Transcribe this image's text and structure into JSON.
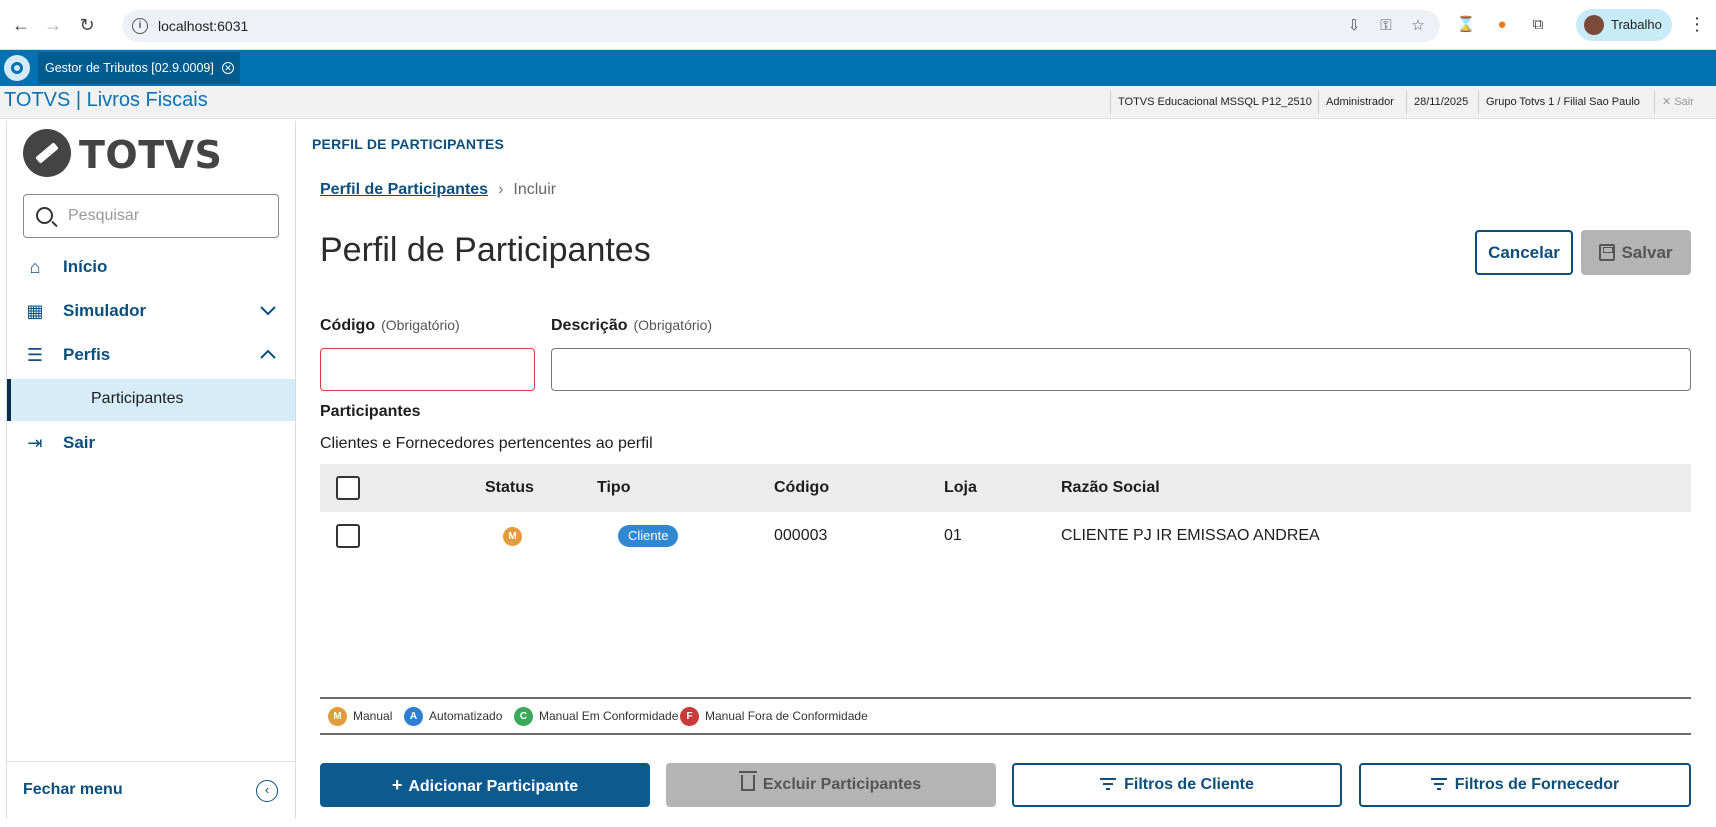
{
  "browser": {
    "url": "localhost:6031",
    "profile_label": "Trabalho"
  },
  "app_tab": {
    "title": "Gestor de Tributos [02.9.0009]"
  },
  "header": {
    "title": "TOTVS | Livros Fiscais",
    "environment": "TOTVS Educacional MSSQL P12_2510",
    "user": "Administrador",
    "date": "28/11/2025",
    "company": "Grupo Totvs 1 / Filial Sao Paulo",
    "exit_label": "Sair"
  },
  "sidebar": {
    "brand": "TOTVS",
    "search_placeholder": "Pesquisar",
    "items": [
      {
        "label": "Início",
        "icon": "home-icon"
      },
      {
        "label": "Simulador",
        "icon": "calculator-icon"
      },
      {
        "label": "Perfis",
        "icon": "list-icon"
      },
      {
        "label": "Sair",
        "icon": "logout-icon"
      }
    ],
    "subitem": "Participantes",
    "footer_label": "Fechar menu"
  },
  "page": {
    "label": "PERFIL DE PARTICIPANTES",
    "breadcrumb_link": "Perfil de Participantes",
    "breadcrumb_current": "Incluir",
    "title": "Perfil de Participantes",
    "cancel_label": "Cancelar",
    "save_label": "Salvar"
  },
  "form": {
    "codigo_label": "Código",
    "codigo_required": "(Obrigatório)",
    "codigo_value": "",
    "descricao_label": "Descrição",
    "descricao_required": "(Obrigatório)",
    "descricao_value": ""
  },
  "participants": {
    "title": "Participantes",
    "subtitle": "Clientes e Fornecedores pertencentes ao perfil",
    "columns": [
      "Status",
      "Tipo",
      "Código",
      "Loja",
      "Razão Social"
    ],
    "rows": [
      {
        "status": "M",
        "tipo": "Cliente",
        "codigo": "000003",
        "loja": "01",
        "razao_social": "CLIENTE PJ IR EMISSAO ANDREA"
      }
    ]
  },
  "legend": [
    {
      "letter": "M",
      "label": "Manual",
      "color": "#e59a3c"
    },
    {
      "letter": "A",
      "label": "Automatizado",
      "color": "#2f7fd0"
    },
    {
      "letter": "C",
      "label": "Manual Em Conformidade",
      "color": "#3aaa5a"
    },
    {
      "letter": "F",
      "label": "Manual Fora de Conformidade",
      "color": "#c93a3a"
    }
  ],
  "actions": {
    "add": "Adicionar Participante",
    "delete": "Excluir Participantes",
    "client_filters": "Filtros de Cliente",
    "supplier_filters": "Filtros de Fornecedor"
  },
  "colors": {
    "primary": "#0c4f7d",
    "tab_bar": "#0072b1"
  }
}
